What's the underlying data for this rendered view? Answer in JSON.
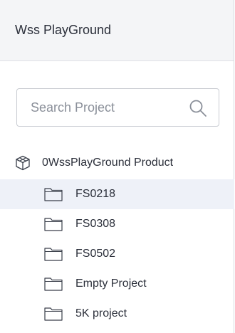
{
  "header": {
    "title": "Wss PlayGround"
  },
  "search": {
    "placeholder": "Search Project",
    "value": ""
  },
  "tree": {
    "product": {
      "label": "0WssPlayGround Product",
      "icon": "cube-icon"
    },
    "items": [
      {
        "label": "FS0218",
        "icon": "folder-icon",
        "selected": true
      },
      {
        "label": "FS0308",
        "icon": "folder-icon",
        "selected": false
      },
      {
        "label": "FS0502",
        "icon": "folder-icon",
        "selected": false
      },
      {
        "label": "Empty Project",
        "icon": "folder-icon",
        "selected": false
      },
      {
        "label": "5K project",
        "icon": "folder-icon",
        "selected": false
      }
    ]
  },
  "colors": {
    "header_bg": "#f4f5f7",
    "selected_bg": "#eef1f8",
    "text": "#2b2f3a",
    "border": "#c9ccd2"
  }
}
